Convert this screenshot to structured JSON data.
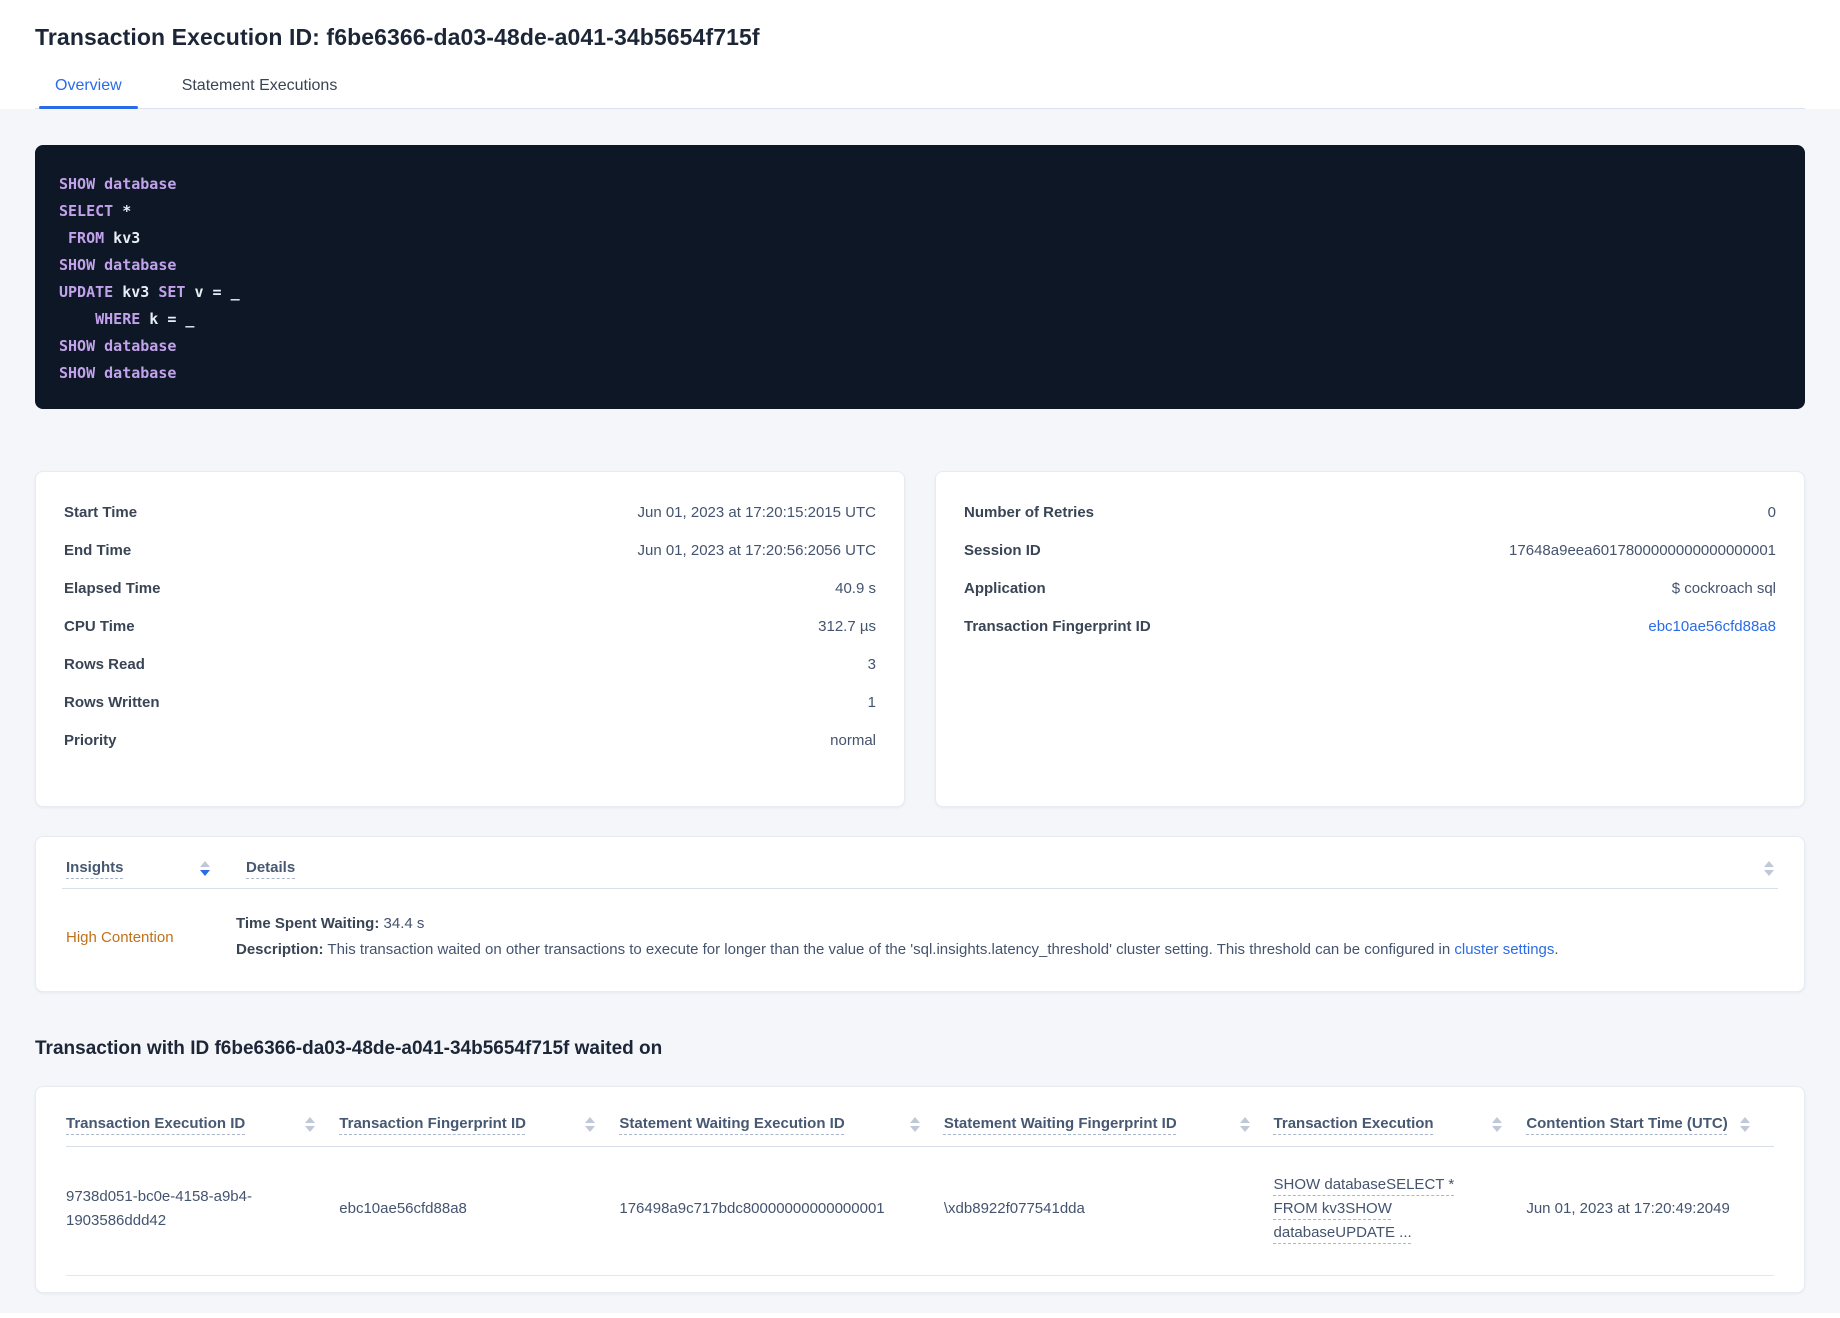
{
  "page": {
    "title": "Transaction Execution ID: f6be6366-da03-48de-a041-34b5654f715f"
  },
  "tabs": [
    {
      "label": "Overview",
      "active": true
    },
    {
      "label": "Statement Executions",
      "active": false
    }
  ],
  "sql": {
    "lines": [
      [
        [
          "k",
          "SHOW"
        ],
        [
          "p",
          " "
        ],
        [
          "k",
          "database"
        ]
      ],
      [
        [
          "k",
          "SELECT"
        ],
        [
          "p",
          " *"
        ]
      ],
      [
        [
          "p",
          " "
        ],
        [
          "k",
          "FROM"
        ],
        [
          "p",
          " kv3"
        ]
      ],
      [
        [
          "k",
          "SHOW"
        ],
        [
          "p",
          " "
        ],
        [
          "k",
          "database"
        ]
      ],
      [
        [
          "k",
          "UPDATE"
        ],
        [
          "p",
          " kv3 "
        ],
        [
          "k",
          "SET"
        ],
        [
          "p",
          " v = _"
        ]
      ],
      [
        [
          "p",
          "    "
        ],
        [
          "k",
          "WHERE"
        ],
        [
          "p",
          " k = _"
        ]
      ],
      [
        [
          "k",
          "SHOW"
        ],
        [
          "p",
          " "
        ],
        [
          "k",
          "database"
        ]
      ],
      [
        [
          "k",
          "SHOW"
        ],
        [
          "p",
          " "
        ],
        [
          "k",
          "database"
        ]
      ]
    ]
  },
  "summary_left": {
    "rows": [
      {
        "label": "Start Time",
        "value": "Jun 01, 2023 at 17:20:15:2015 UTC"
      },
      {
        "label": "End Time",
        "value": "Jun 01, 2023 at 17:20:56:2056 UTC"
      },
      {
        "label": "Elapsed Time",
        "value": "40.9 s"
      },
      {
        "label": "CPU Time",
        "value": "312.7 µs"
      },
      {
        "label": "Rows Read",
        "value": "3"
      },
      {
        "label": "Rows Written",
        "value": "1"
      },
      {
        "label": "Priority",
        "value": "normal"
      }
    ]
  },
  "summary_right": {
    "rows": [
      {
        "label": "Number of Retries",
        "value": "0"
      },
      {
        "label": "Session ID",
        "value": "17648a9eea6017800000000000000001"
      },
      {
        "label": "Application",
        "value": "$ cockroach sql"
      },
      {
        "label": "Transaction Fingerprint ID",
        "value": "ebc10ae56cfd88a8"
      }
    ]
  },
  "insights": {
    "columns": {
      "insights": "Insights",
      "details": "Details"
    },
    "row": {
      "insight": "High Contention",
      "waiting_label": "Time Spent Waiting:",
      "waiting_value": " 34.4 s",
      "description_label": "Description:",
      "description_text": " This transaction waited on other transactions to execute for longer than the value of the 'sql.insights.latency_threshold' cluster setting. This threshold can be configured in ",
      "description_link": "cluster settings",
      "description_suffix": "."
    }
  },
  "waited_on": {
    "heading": "Transaction with ID f6be6366-da03-48de-a041-34b5654f715f waited on",
    "columns": [
      "Transaction Execution ID",
      "Transaction Fingerprint ID",
      "Statement Waiting Execution ID",
      "Statement Waiting Fingerprint ID",
      "Transaction Execution",
      "Contention Start Time (UTC)"
    ],
    "rows": [
      {
        "txn_exec_id": "9738d051-bc0e-4158-a9b4-1903586ddd42",
        "txn_fingerprint_id": "ebc10ae56cfd88a8",
        "stmt_waiting_exec_id": "176498a9c717bdc80000000000000001",
        "stmt_waiting_fingerprint_id": "\\xdb8922f077541dda",
        "txn_execution": "SHOW databaseSELECT * FROM kv3SHOW databaseUPDATE ...",
        "contention_start": "Jun 01, 2023 at 17:20:49:2049"
      }
    ]
  },
  "colors": {
    "accent_blue": "#2a6ce8",
    "warning_orange": "#c0701b",
    "code_background": "#0e1726",
    "code_keyword": "#c2a2ea"
  }
}
